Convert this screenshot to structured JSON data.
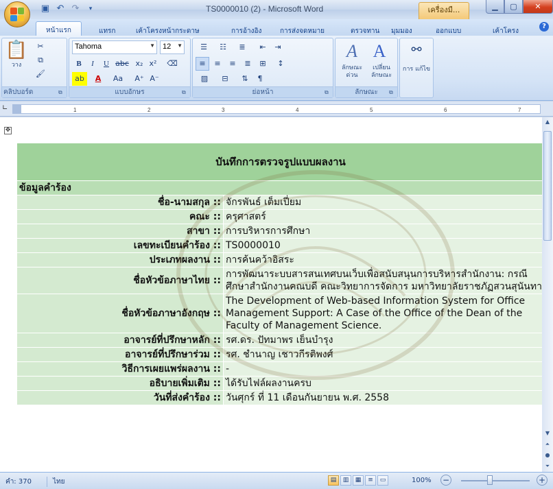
{
  "window": {
    "title": "TS0000010 (2) - Microsoft Word",
    "context_tab": "เครื่องมื..."
  },
  "ribbon_tabs": [
    {
      "label": "หน้าแรก",
      "active": true
    },
    {
      "label": "แทรก"
    },
    {
      "label": "เค้าโครงหน้ากระดาษ"
    },
    {
      "label": "การอ้างอิง"
    },
    {
      "label": "การส่งจดหมาย"
    },
    {
      "label": "ตรวจทาน"
    },
    {
      "label": "มุมมอง"
    },
    {
      "label": "ออกแบบ"
    },
    {
      "label": "เค้าโครง"
    }
  ],
  "ribbon": {
    "clipboard": {
      "label": "คลิปบอร์ด",
      "paste_label": "วาง"
    },
    "font": {
      "label": "แบบอักษร",
      "font_name": "Tahoma",
      "font_size": "12"
    },
    "paragraph": {
      "label": "ย่อหน้า"
    },
    "styles": {
      "label": "ลักษณะ",
      "quick_styles": "ลักษณะ ด่วน",
      "change_styles": "เปลี่ยน ลักษณะ"
    },
    "editing": {
      "label": "การ แก้ไข"
    }
  },
  "ruler": {
    "ticks": [
      "1",
      "2",
      "3",
      "4",
      "5",
      "6",
      "7"
    ]
  },
  "document": {
    "header": "บันทึกการตรวจรูปแบบผลงาน",
    "section": "ข้อมูลคำร้อง",
    "separator": "::",
    "rows": [
      {
        "label": "ชื่อ-นามสกุล",
        "value": "จักรพันธ์ เต็มเปี่ยม"
      },
      {
        "label": "คณะ",
        "value": "ครุศาสตร์"
      },
      {
        "label": "สาขา",
        "value": "การบริหารการศึกษา"
      },
      {
        "label": "เลขทะเบียนคำร้อง",
        "value": "TS0000010"
      },
      {
        "label": "ประเภทผลงาน",
        "value": "การค้นคว้าอิสระ"
      },
      {
        "label": "ชื่อหัวข้อภาษาไทย",
        "value": "การพัฒนาระบบสารสนเทศบนเว็บเพื่อสนับสนุนการบริหารสำนักงาน: กรณีศึกษาสำนักงานคณบดี คณะวิทยาการจัดการ มหาวิทยาลัยราชภัฏสวนสุนันทา"
      },
      {
        "label": "ชื่อหัวข้อภาษาอังกฤษ",
        "value": "The Development of Web-based Information System for Office Management Support: A Case of the Office of the Dean of the Faculty of Management Science."
      },
      {
        "label": "อาจารย์ที่ปรึกษาหลัก",
        "value": "รศ.ดร. ปัทมาพร เย็นบำรุง"
      },
      {
        "label": "อาจารย์ที่ปรึกษาร่วม",
        "value": "รศ. ชำนาญ เชาวกีรติพงศ์"
      },
      {
        "label": "วิธีการเผยแพร่ผลงาน",
        "value": "-"
      },
      {
        "label": "อธิบายเพิ่มเติม",
        "value": "ได้รับไฟล์ผลงานครบ"
      },
      {
        "label": "วันที่ส่งคำร้อง",
        "value": "วันศุกร์ ที่ 11 เดือนกันยายน พ.ศ. 2558"
      }
    ]
  },
  "statusbar": {
    "words": "คำ: 370",
    "language": "ไทย",
    "zoom": "100%"
  }
}
